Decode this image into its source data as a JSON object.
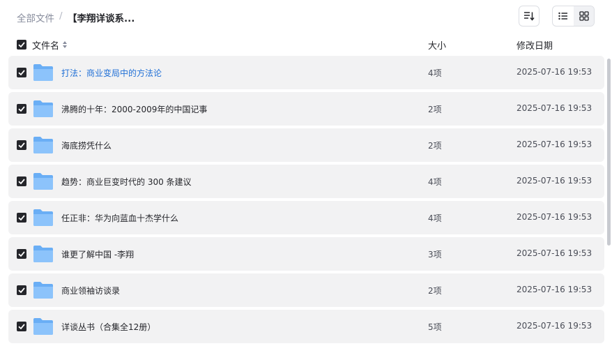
{
  "breadcrumb": {
    "root": "全部文件",
    "separator": "/",
    "current": "【李翔详谈系..."
  },
  "toolbar": {
    "sort_icon": "sort-descending-icon",
    "list_view_icon": "list-view-icon",
    "grid_view_icon": "grid-view-icon"
  },
  "columns": {
    "name": "文件名",
    "size": "大小",
    "modified": "修改日期"
  },
  "colors": {
    "checkbox": "#25262b",
    "link": "#1f6fd6",
    "folder": "#6aaef5",
    "row_bg": "#f2f2f3"
  },
  "files": [
    {
      "name": "打法：商业变局中的方法论",
      "size": "4项",
      "modified": "2025-07-16 19:53",
      "checked": true
    },
    {
      "name": "沸腾的十年：2000-2009年的中国记事",
      "size": "2项",
      "modified": "2025-07-16 19:53",
      "checked": true
    },
    {
      "name": "海底捞凭什么",
      "size": "2项",
      "modified": "2025-07-16 19:53",
      "checked": true
    },
    {
      "name": "趋势：商业巨变时代的 300 条建议",
      "size": "4项",
      "modified": "2025-07-16 19:53",
      "checked": true
    },
    {
      "name": "任正非：华为向蓝血十杰学什么",
      "size": "4项",
      "modified": "2025-07-16 19:53",
      "checked": true
    },
    {
      "name": "谁更了解中国 -李翔",
      "size": "3项",
      "modified": "2025-07-16 19:53",
      "checked": true
    },
    {
      "name": "商业领袖访谈录",
      "size": "2项",
      "modified": "2025-07-16 19:53",
      "checked": true
    },
    {
      "name": "详谈丛书（合集全12册）",
      "size": "5项",
      "modified": "2025-07-16 19:53",
      "checked": true
    }
  ]
}
